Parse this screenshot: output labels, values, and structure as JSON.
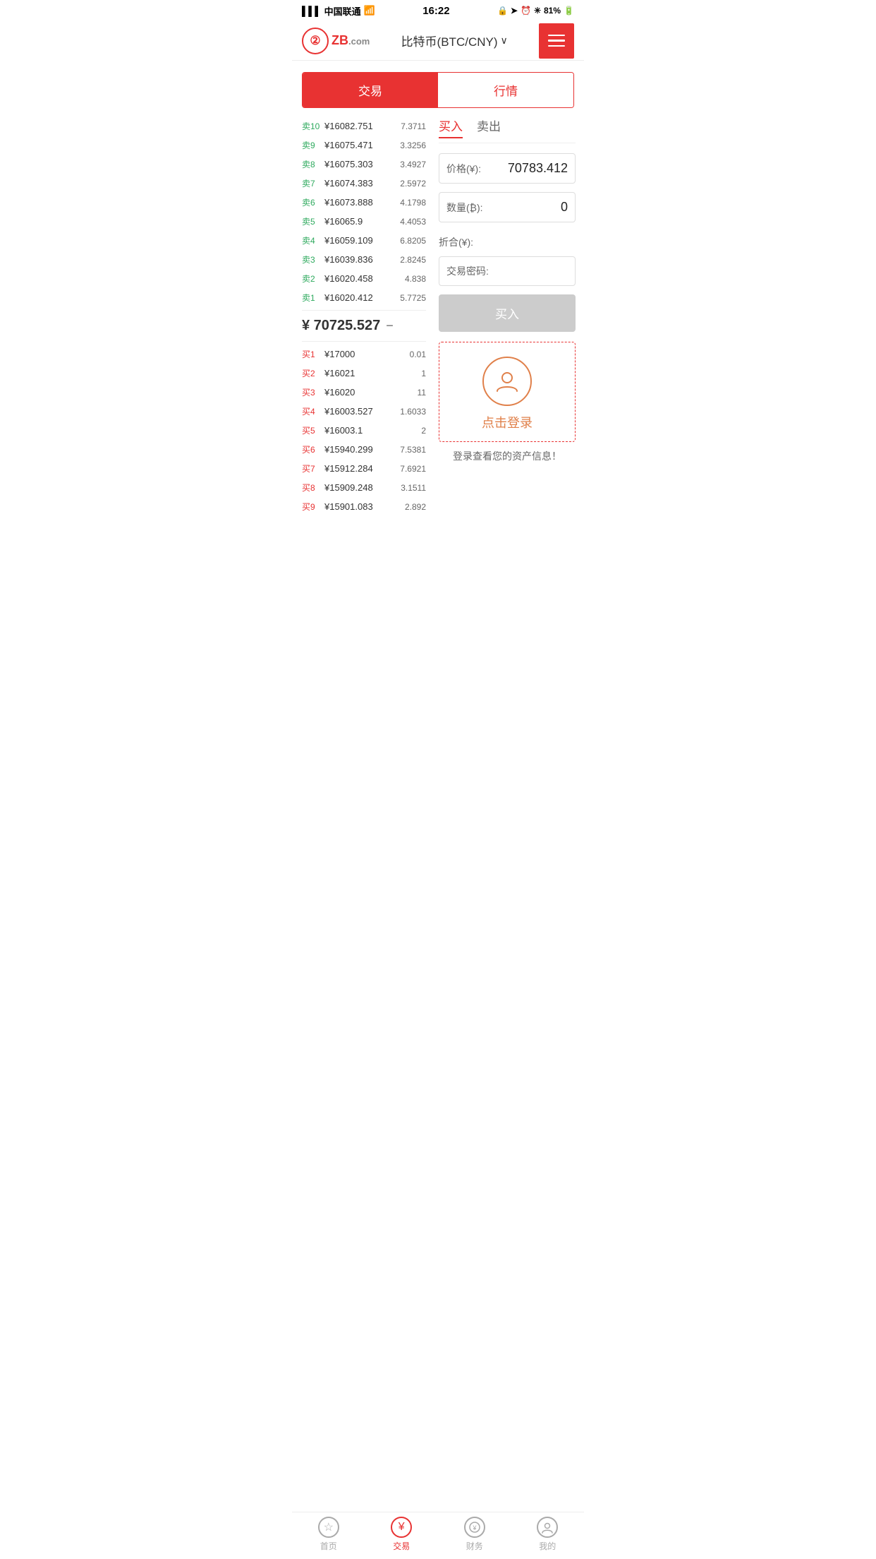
{
  "statusBar": {
    "carrier": "中国联通",
    "time": "16:22",
    "battery": "81%"
  },
  "header": {
    "logoText": "ZB",
    "logoDomain": ".com",
    "title": "比特币(BTC/CNY)",
    "menuLabel": "menu"
  },
  "mainTabs": [
    {
      "label": "交易",
      "active": true
    },
    {
      "label": "行情",
      "active": false
    }
  ],
  "orderBook": {
    "sellOrders": [
      {
        "label": "卖10",
        "price": "¥16082.751",
        "amount": "7.3711"
      },
      {
        "label": "卖9",
        "price": "¥16075.471",
        "amount": "3.3256"
      },
      {
        "label": "卖8",
        "price": "¥16075.303",
        "amount": "3.4927"
      },
      {
        "label": "卖7",
        "price": "¥16074.383",
        "amount": "2.5972"
      },
      {
        "label": "卖6",
        "price": "¥16073.888",
        "amount": "4.1798"
      },
      {
        "label": "卖5",
        "price": "¥16065.9",
        "amount": "4.4053"
      },
      {
        "label": "卖4",
        "price": "¥16059.109",
        "amount": "6.8205"
      },
      {
        "label": "卖3",
        "price": "¥16039.836",
        "amount": "2.8245"
      },
      {
        "label": "卖2",
        "price": "¥16020.458",
        "amount": "4.838"
      },
      {
        "label": "卖1",
        "price": "¥16020.412",
        "amount": "5.7725"
      }
    ],
    "currentPrice": "¥ 70725.527",
    "currentPriceSymbol": "−",
    "buyOrders": [
      {
        "label": "买1",
        "price": "¥17000",
        "amount": "0.01"
      },
      {
        "label": "买2",
        "price": "¥16021",
        "amount": "1"
      },
      {
        "label": "买3",
        "price": "¥16020",
        "amount": "11"
      },
      {
        "label": "买4",
        "price": "¥16003.527",
        "amount": "1.6033"
      },
      {
        "label": "买5",
        "price": "¥16003.1",
        "amount": "2"
      },
      {
        "label": "买6",
        "price": "¥15940.299",
        "amount": "7.5381"
      },
      {
        "label": "买7",
        "price": "¥15912.284",
        "amount": "7.6921"
      },
      {
        "label": "买8",
        "price": "¥15909.248",
        "amount": "3.1511"
      },
      {
        "label": "买9",
        "price": "¥15901.083",
        "amount": "2.892"
      }
    ]
  },
  "tradePanel": {
    "tabs": [
      {
        "label": "买入",
        "active": true
      },
      {
        "label": "卖出",
        "active": false
      }
    ],
    "priceLabel": "价格(¥):",
    "priceValue": "70783.412",
    "quantityLabel": "数量(₿):",
    "quantityValue": "0",
    "foldLabel": "折合(¥):",
    "passwordLabel": "交易密码:",
    "buyButtonLabel": "买入",
    "loginPrompt": {
      "loginText": "点击登录",
      "assetInfo": "登录查看您的资产信息！"
    }
  },
  "bottomNav": [
    {
      "label": "首页",
      "icon": "★",
      "active": false
    },
    {
      "label": "交易",
      "icon": "¥",
      "active": true
    },
    {
      "label": "财务",
      "icon": "💰",
      "active": false
    },
    {
      "label": "我的",
      "icon": "👤",
      "active": false
    }
  ]
}
